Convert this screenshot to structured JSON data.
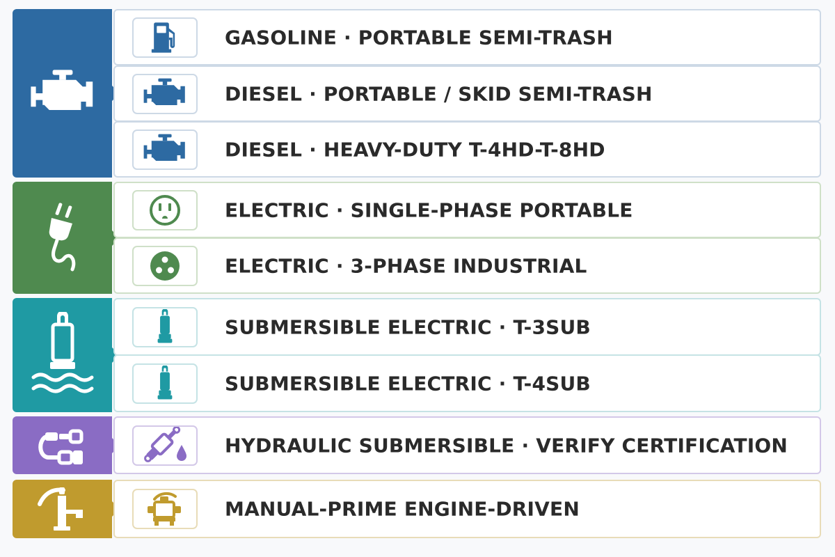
{
  "colors": {
    "engine": "#2d6aa2",
    "electric": "#4f8a4f",
    "submersible": "#1f9aa3",
    "hydraulic": "#8a6cc4",
    "manual": "#c09b2e",
    "text": "#2a2a2a"
  },
  "groups": [
    {
      "category_icon": "engine-icon",
      "rows": [
        {
          "icon": "fuel-pump-icon",
          "label": "GASOLINE · PORTABLE SEMI-TRASH"
        },
        {
          "icon": "engine-icon",
          "label": "DIESEL · PORTABLE / SKID SEMI-TRASH"
        },
        {
          "icon": "engine-icon",
          "label": "DIESEL · HEAVY-DUTY T-4HD-T-8HD"
        }
      ]
    },
    {
      "category_icon": "plug-icon",
      "rows": [
        {
          "icon": "outlet-icon",
          "label": "ELECTRIC · SINGLE-PHASE PORTABLE"
        },
        {
          "icon": "three-phase-socket-icon",
          "label": "ELECTRIC · 3-PHASE INDUSTRIAL"
        }
      ]
    },
    {
      "category_icon": "submersible-pump-water-icon",
      "rows": [
        {
          "icon": "submersible-pump-icon",
          "label": "SUBMERSIBLE ELECTRIC · T-3SUB"
        },
        {
          "icon": "submersible-pump-icon",
          "label": "SUBMERSIBLE ELECTRIC · T-4SUB"
        }
      ]
    },
    {
      "category_icon": "hydraulic-hose-icon",
      "rows": [
        {
          "icon": "hydraulic-cylinder-drop-icon",
          "label": "HYDRAULIC SUBMERSIBLE · VERIFY CERTIFICATION"
        }
      ]
    },
    {
      "category_icon": "hand-pump-icon",
      "rows": [
        {
          "icon": "engine-driven-pump-icon",
          "label": "MANUAL-PRIME ENGINE-DRIVEN"
        }
      ]
    }
  ]
}
